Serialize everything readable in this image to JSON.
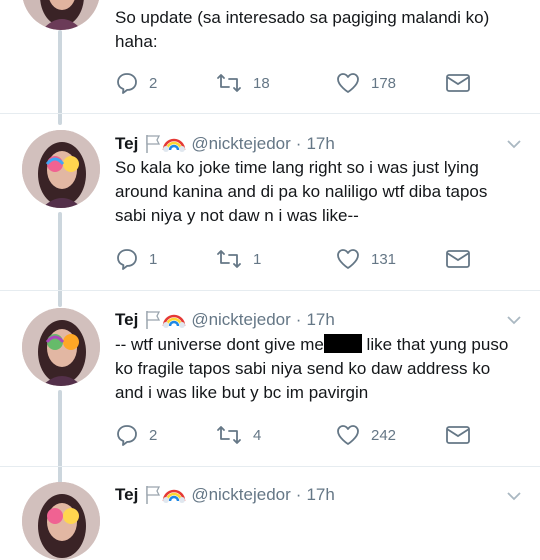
{
  "tweets": [
    {
      "text": "So update (sa interesado sa pagiging malandi ko) haha:",
      "replies": "2",
      "retweets": "18",
      "likes": "178"
    },
    {
      "name": "Tej",
      "handle": "@nicktejedor",
      "separator": "·",
      "time": "17h",
      "text": "So kala ko joke time lang right so i was just lying around kanina and di pa ko naliligo wtf diba tapos sabi niya y not daw n i was like--",
      "replies": "1",
      "retweets": "1",
      "likes": "131"
    },
    {
      "name": "Tej",
      "handle": "@nicktejedor",
      "separator": "·",
      "time": "17h",
      "text_before": "-- wtf universe dont give me",
      "text_after": " like that yung puso ko fragile tapos sabi niya send ko daw address ko and i was like but y bc im pavirgin",
      "replies": "2",
      "retweets": "4",
      "likes": "242"
    },
    {
      "name": "Tej",
      "handle": "@nicktejedor",
      "separator": "·",
      "time": "17h"
    }
  ],
  "icons": {
    "reply": "reply-icon",
    "retweet": "retweet-icon",
    "like": "heart-icon",
    "dm": "envelope-icon",
    "caret": "chevron-down-icon",
    "flag": "white-flag-icon",
    "rainbow": "rainbow-icon"
  },
  "colors": {
    "text": "#14171a",
    "secondary": "#657786",
    "thread": "#ccd6dd"
  }
}
